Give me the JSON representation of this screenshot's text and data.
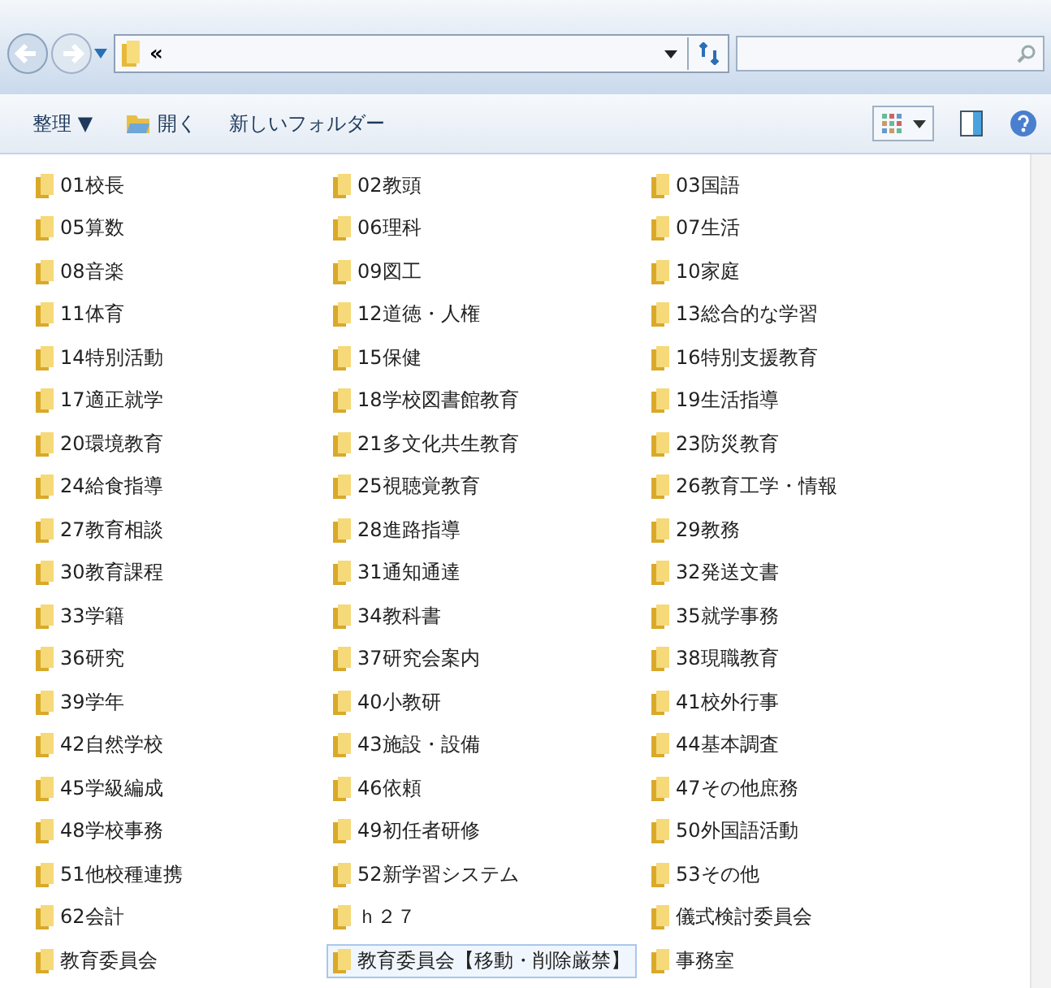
{
  "address_bar": {
    "path": "«"
  },
  "command_bar": {
    "organize": "整理 ▼",
    "open": "開く",
    "new_folder": "新しいフォルダー"
  },
  "folders": [
    {
      "name": "01校長",
      "selected": false
    },
    {
      "name": "02教頭",
      "selected": false
    },
    {
      "name": "03国語",
      "selected": false
    },
    {
      "name": "05算数",
      "selected": false
    },
    {
      "name": "06理科",
      "selected": false
    },
    {
      "name": "07生活",
      "selected": false
    },
    {
      "name": "08音楽",
      "selected": false
    },
    {
      "name": "09図工",
      "selected": false
    },
    {
      "name": "10家庭",
      "selected": false
    },
    {
      "name": "11体育",
      "selected": false
    },
    {
      "name": "12道徳・人権",
      "selected": false
    },
    {
      "name": "13総合的な学習",
      "selected": false
    },
    {
      "name": "14特別活動",
      "selected": false
    },
    {
      "name": "15保健",
      "selected": false
    },
    {
      "name": "16特別支援教育",
      "selected": false
    },
    {
      "name": "17適正就学",
      "selected": false
    },
    {
      "name": "18学校図書館教育",
      "selected": false
    },
    {
      "name": "19生活指導",
      "selected": false
    },
    {
      "name": "20環境教育",
      "selected": false
    },
    {
      "name": "21多文化共生教育",
      "selected": false
    },
    {
      "name": "23防災教育",
      "selected": false
    },
    {
      "name": "24給食指導",
      "selected": false
    },
    {
      "name": "25視聴覚教育",
      "selected": false
    },
    {
      "name": "26教育工学・情報",
      "selected": false
    },
    {
      "name": "27教育相談",
      "selected": false
    },
    {
      "name": "28進路指導",
      "selected": false
    },
    {
      "name": "29教務",
      "selected": false
    },
    {
      "name": "30教育課程",
      "selected": false
    },
    {
      "name": "31通知通達",
      "selected": false
    },
    {
      "name": "32発送文書",
      "selected": false
    },
    {
      "name": "33学籍",
      "selected": false
    },
    {
      "name": "34教科書",
      "selected": false
    },
    {
      "name": "35就学事務",
      "selected": false
    },
    {
      "name": "36研究",
      "selected": false
    },
    {
      "name": "37研究会案内",
      "selected": false
    },
    {
      "name": "38現職教育",
      "selected": false
    },
    {
      "name": "39学年",
      "selected": false
    },
    {
      "name": "40小教研",
      "selected": false
    },
    {
      "name": "41校外行事",
      "selected": false
    },
    {
      "name": "42自然学校",
      "selected": false
    },
    {
      "name": "43施設・設備",
      "selected": false
    },
    {
      "name": "44基本調査",
      "selected": false
    },
    {
      "name": "45学級編成",
      "selected": false
    },
    {
      "name": "46依頼",
      "selected": false
    },
    {
      "name": "47その他庶務",
      "selected": false
    },
    {
      "name": "48学校事務",
      "selected": false
    },
    {
      "name": "49初任者研修",
      "selected": false
    },
    {
      "name": "50外国語活動",
      "selected": false
    },
    {
      "name": "51他校種連携",
      "selected": false
    },
    {
      "name": "52新学習システム",
      "selected": false
    },
    {
      "name": "53その他",
      "selected": false
    },
    {
      "name": "62会計",
      "selected": false
    },
    {
      "name": "ｈ２７",
      "selected": false
    },
    {
      "name": "儀式検討委員会",
      "selected": false
    },
    {
      "name": "教育委員会",
      "selected": false
    },
    {
      "name": "教育委員会【移動・削除厳禁】",
      "selected": true
    },
    {
      "name": "事務室",
      "selected": false
    }
  ]
}
